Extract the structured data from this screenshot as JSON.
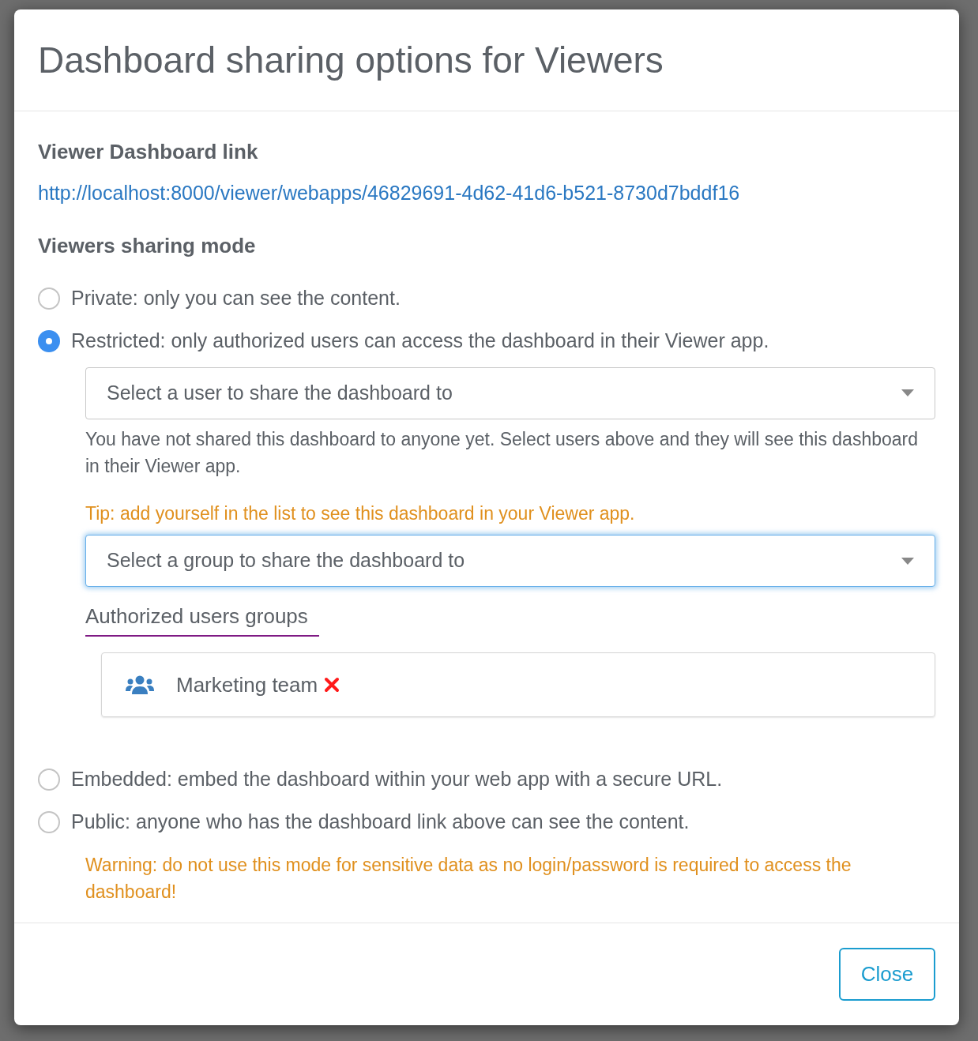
{
  "dialog": {
    "title": "Dashboard sharing options for Viewers"
  },
  "link_section": {
    "heading": "Viewer Dashboard link",
    "url": "http://localhost:8000/viewer/webapps/46829691-4d62-41d6-b521-8730d7bddf16"
  },
  "mode_section": {
    "heading": "Viewers sharing mode"
  },
  "modes": [
    {
      "label": "Private: only you can see the content.",
      "selected": false
    },
    {
      "label": "Restricted: only authorized users can access the dashboard in their Viewer app.",
      "selected": true,
      "details": {
        "user_select": {
          "placeholder": "Select a user to share the dashboard to",
          "focused": false
        },
        "help": "You have not shared this dashboard to anyone yet. Select users above and they will see this dashboard in their Viewer app.",
        "tip": "Tip: add yourself in the list to see this dashboard in your Viewer app.",
        "group_select": {
          "placeholder": "Select a group to share the dashboard to",
          "focused": true
        },
        "groups_heading": "Authorized users groups",
        "groups": [
          {
            "name": "Marketing team"
          }
        ]
      }
    },
    {
      "label": "Embedded: embed the dashboard within your web app with a secure URL.",
      "selected": false
    },
    {
      "label": "Public: anyone who has the dashboard link above can see the content.",
      "selected": false,
      "warning": "Warning: do not use this mode for sensitive data as no login/password is required to access the dashboard!"
    }
  ],
  "buttons": [
    {
      "label": "Close"
    }
  ]
}
